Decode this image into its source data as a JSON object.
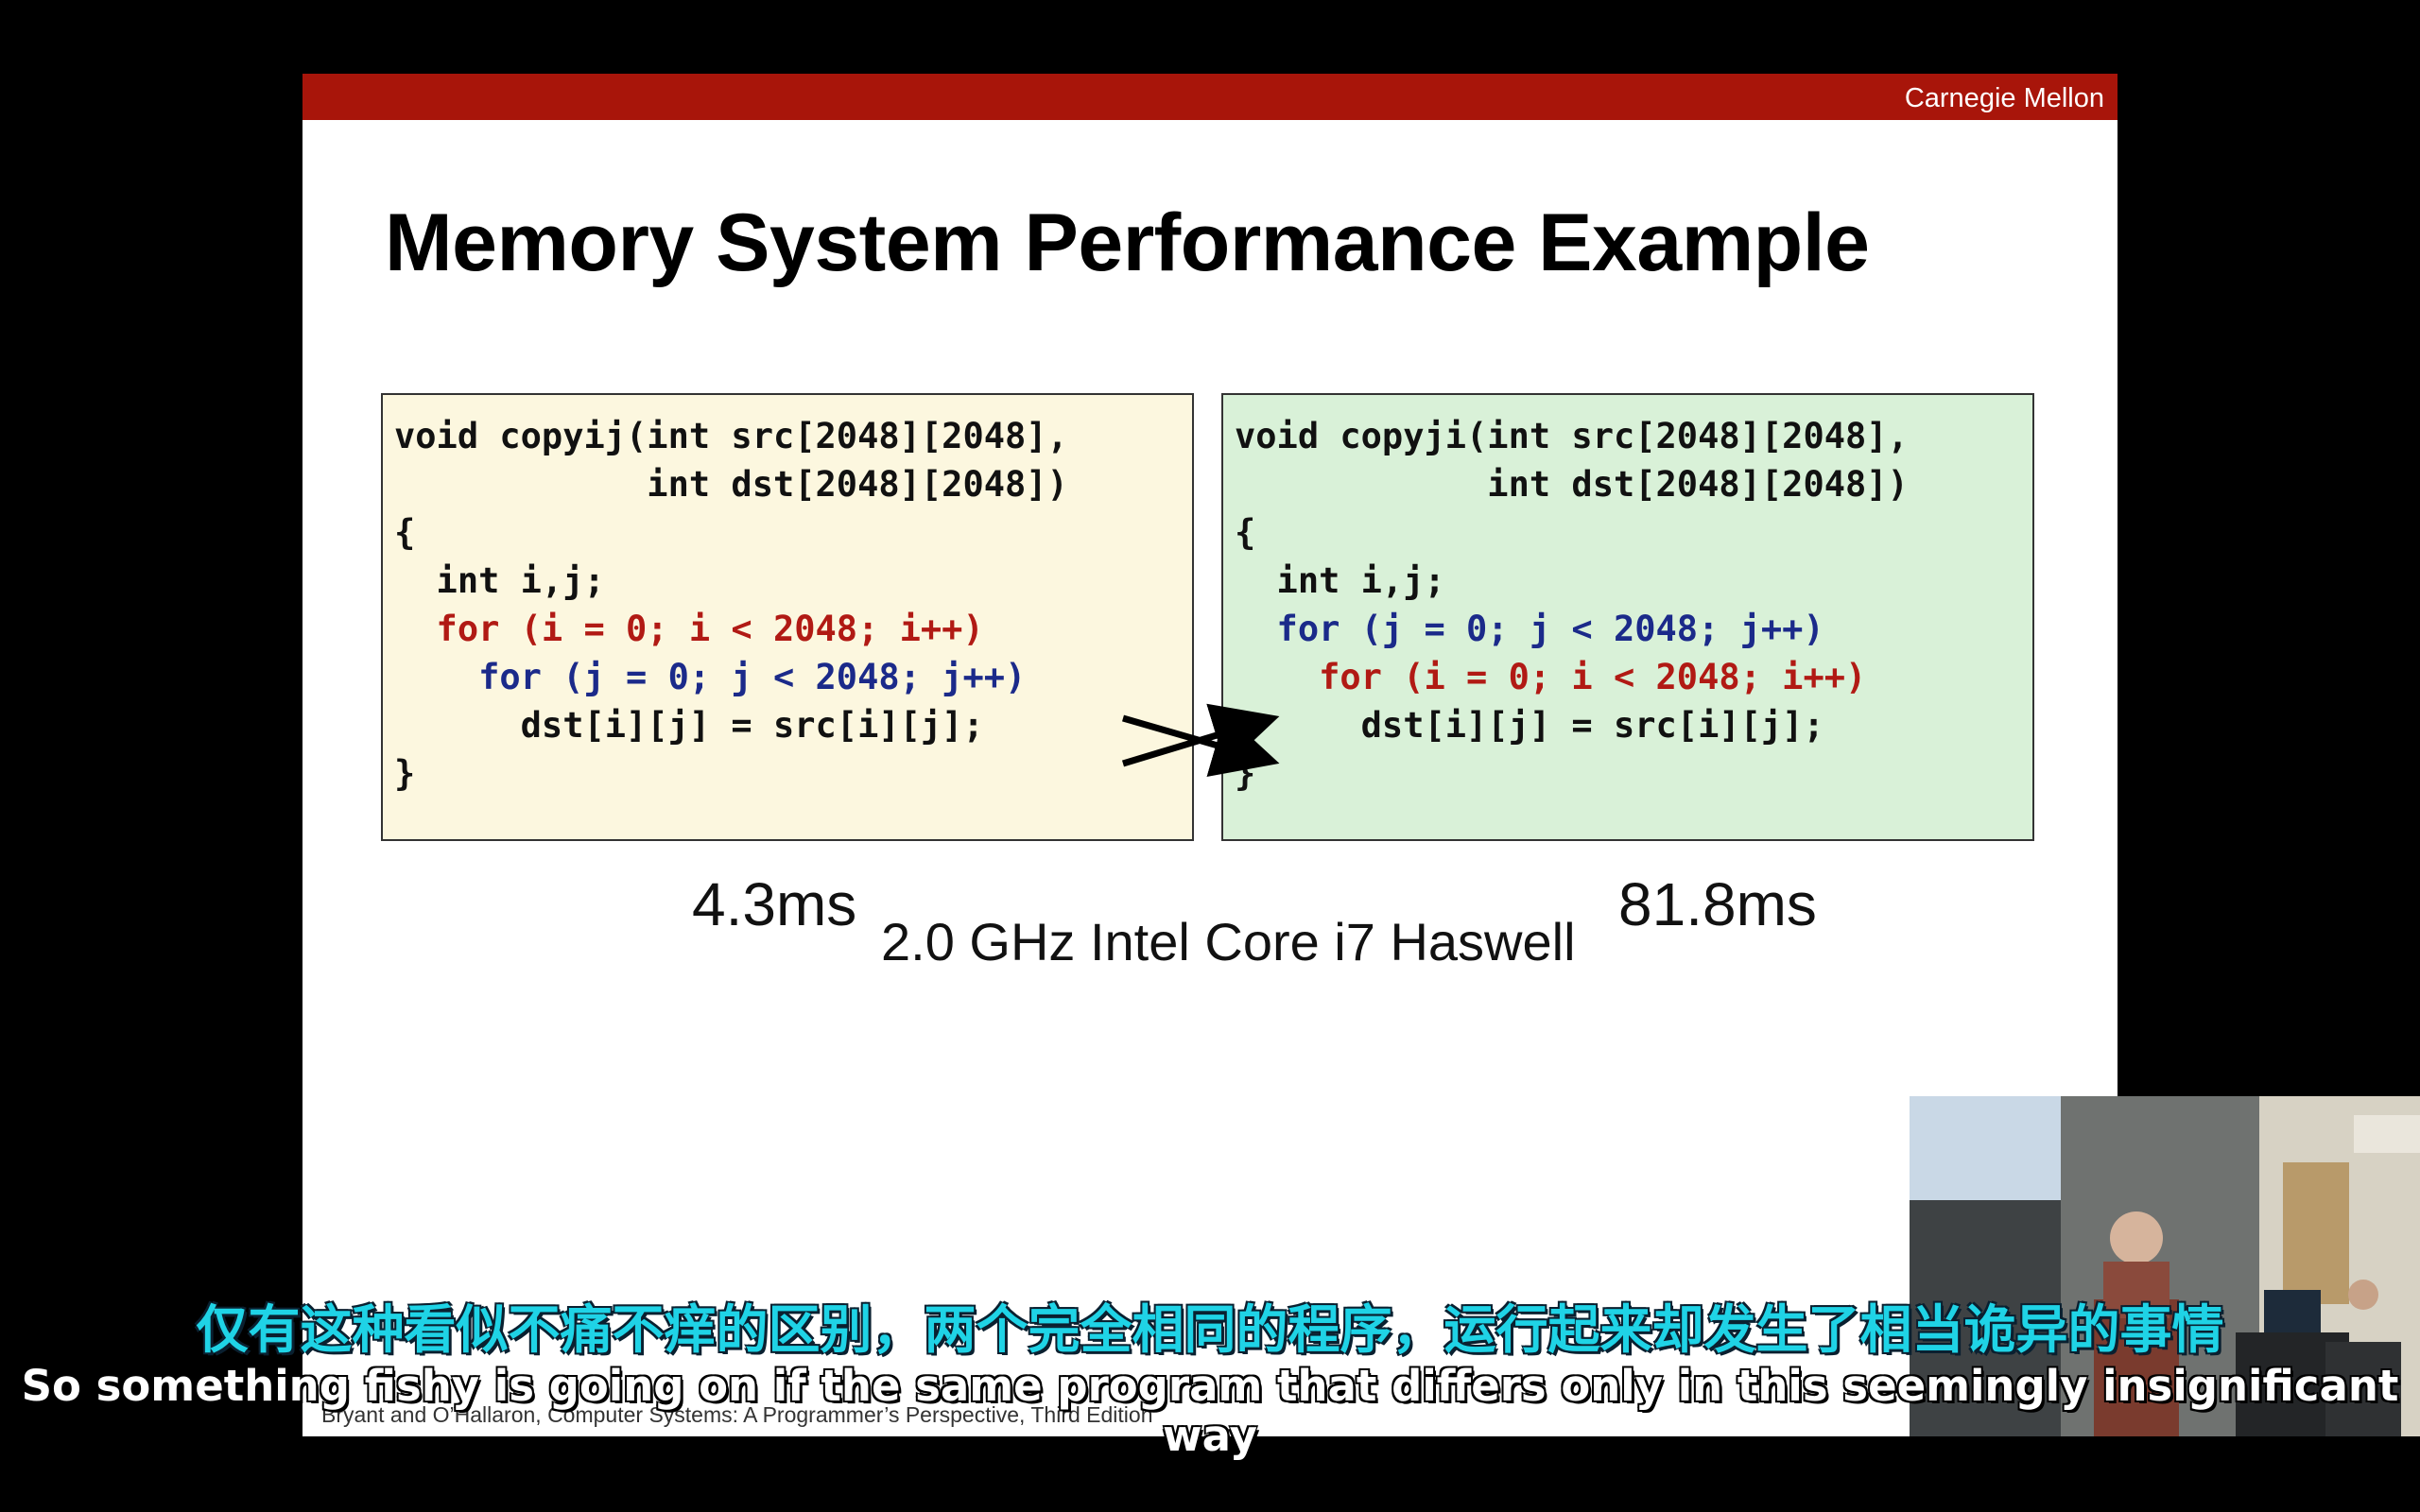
{
  "slide": {
    "brand": "Carnegie Mellon",
    "title": "Memory System Performance Example",
    "left_code": {
      "line1": "void copyij(int src[2048][2048],",
      "line2": "            int dst[2048][2048])",
      "line3": "{",
      "line4": "  int i,j;",
      "line5": "  for (i = 0; i < 2048; i++)",
      "line6": "    for (j = 0; j < 2048; j++)",
      "line7": "      dst[i][j] = src[i][j];",
      "line8": "}"
    },
    "right_code": {
      "line1": "void copyji(int src[2048][2048],",
      "line2": "            int dst[2048][2048])",
      "line3": "{",
      "line4": "  int i,j;",
      "line5": "  for (j = 0; j < 2048; j++)",
      "line6": "    for (i = 0; i < 2048; i++)",
      "line7": "      dst[i][j] = src[i][j];",
      "line8": "}"
    },
    "left_time": "4.3ms",
    "right_time": "81.8ms",
    "cpu": "2.0 GHz Intel Core i7 Haswell",
    "footer": "Bryant and O’Hallaron, Computer Systems: A Programmer’s Perspective, Third Edition"
  },
  "subtitles": {
    "chinese": "仅有这种看似不痛不痒的区别，两个完全相同的程序，运行起来却发生了相当诡异的事情",
    "english": "So something fishy is going on if the same program that differs only in this seemingly insignificant way"
  },
  "colors": {
    "topbar": "#a8150a",
    "left_box": "#fcf7df",
    "right_box": "#d9f1d8",
    "outer_loop_red": "#b11a14",
    "inner_loop_blue": "#1b2a8a",
    "chinese_subtitle": "#1fd3e6"
  },
  "webcam": {
    "icon": "lecturer-video-feed"
  }
}
